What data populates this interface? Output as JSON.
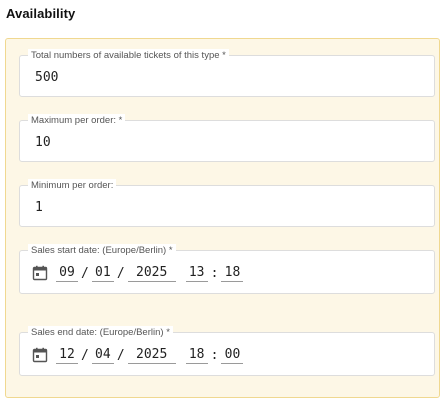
{
  "section": {
    "title": "Availability"
  },
  "fields": {
    "total_tickets": {
      "label": "Total numbers of available tickets of this type *",
      "value": "500"
    },
    "max_per_order": {
      "label": "Maximum per order: *",
      "value": "10"
    },
    "min_per_order": {
      "label": "Minimum per order:",
      "value": "1"
    },
    "sales_start": {
      "label": "Sales start date: (Europe/Berlin) *",
      "day": "09",
      "month": "01",
      "year": "2025",
      "hour": "13",
      "minute": "18"
    },
    "sales_end": {
      "label": "Sales end date: (Europe/Berlin) *",
      "day": "12",
      "month": "04",
      "year": "2025",
      "hour": "18",
      "minute": "00"
    }
  },
  "separators": {
    "date": "/",
    "time": ":"
  },
  "icons": {
    "calendar": "calendar-icon"
  },
  "colors": {
    "panel_bg": "#fdf7e6",
    "panel_border": "#f0d890"
  }
}
